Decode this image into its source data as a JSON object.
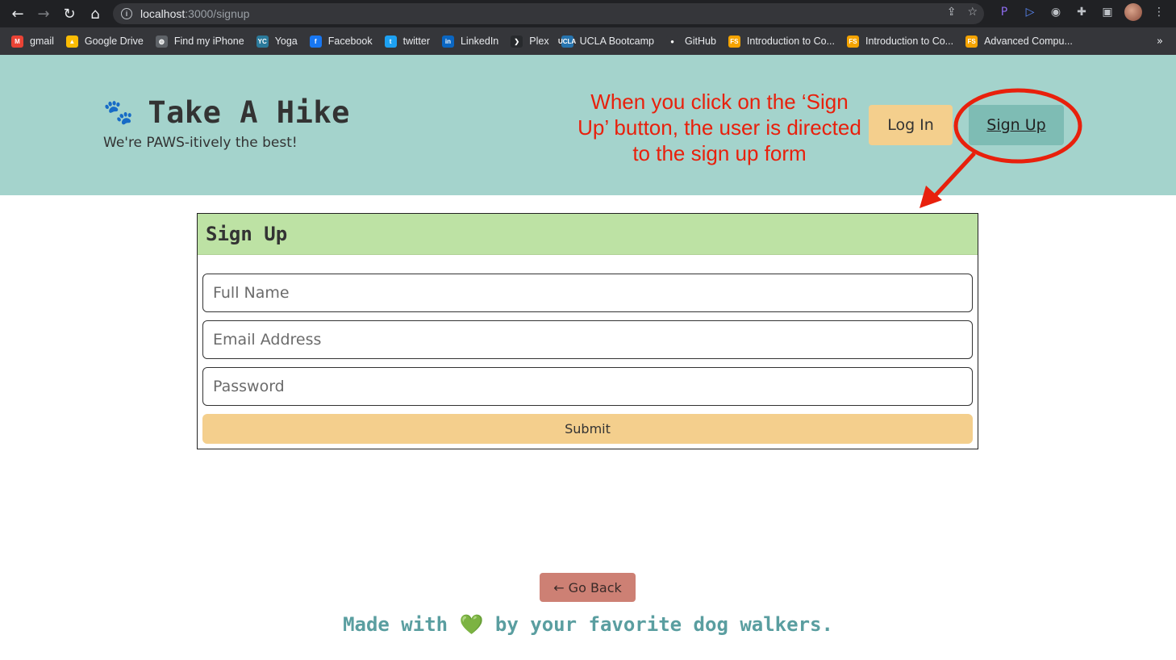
{
  "browser": {
    "url_host": "localhost",
    "url_path": ":3000/signup",
    "bookmarks": [
      {
        "label": "gmail",
        "icon": "gmail-icon",
        "color": "#ea4335",
        "glyph": "M"
      },
      {
        "label": "Google Drive",
        "icon": "google-drive-icon",
        "color": "#fbbc04",
        "glyph": "▲"
      },
      {
        "label": "Find my iPhone",
        "icon": "globe-icon",
        "color": "#5f6368",
        "glyph": "◍"
      },
      {
        "label": "Yoga",
        "icon": "yc-icon",
        "color": "#2b7a9b",
        "glyph": "YC"
      },
      {
        "label": "Facebook",
        "icon": "facebook-icon",
        "color": "#1877f2",
        "glyph": "f"
      },
      {
        "label": "twitter",
        "icon": "twitter-icon",
        "color": "#1da1f2",
        "glyph": "t"
      },
      {
        "label": "LinkedIn",
        "icon": "linkedin-icon",
        "color": "#0a66c2",
        "glyph": "in"
      },
      {
        "label": "Plex",
        "icon": "plex-icon",
        "color": "#282a2d",
        "glyph": "❯"
      },
      {
        "label": "UCLA Bootcamp",
        "icon": "ucla-icon",
        "color": "#2774ae",
        "glyph": "UCLA"
      },
      {
        "label": "GitHub",
        "icon": "github-icon",
        "color": "#35363a",
        "glyph": "●"
      },
      {
        "label": "Introduction to Co...",
        "icon": "fs-icon",
        "color": "#f4a300",
        "glyph": "FS"
      },
      {
        "label": "Introduction to Co...",
        "icon": "fs-icon",
        "color": "#f4a300",
        "glyph": "FS"
      },
      {
        "label": "Advanced Compu...",
        "icon": "fs-icon",
        "color": "#f4a300",
        "glyph": "FS"
      }
    ],
    "more_label": "»"
  },
  "header": {
    "paw": "🐾",
    "title": "Take A Hike",
    "tagline": "We're PAWS-itively the best!",
    "login_label": "Log In",
    "signup_label": "Sign Up"
  },
  "annotation": {
    "text": "When you click on the ‘Sign Up’ button, the user is directed to the sign up form",
    "color": "#e8200c"
  },
  "form": {
    "title": "Sign Up",
    "name_placeholder": "Full Name",
    "email_placeholder": "Email Address",
    "password_placeholder": "Password",
    "submit_label": "Submit"
  },
  "footer": {
    "go_back_label": "← Go Back",
    "text_before": "Made with ",
    "heart": "💚",
    "text_after": " by your favorite dog walkers."
  },
  "colors": {
    "header_bg": "#a4d3cc",
    "form_header_bg": "#bde2a4",
    "login_bg": "#f4cf8d",
    "signup_bg": "#7ebcb4",
    "go_back_bg": "#cd8074",
    "footer_text": "#5a9ea0"
  }
}
